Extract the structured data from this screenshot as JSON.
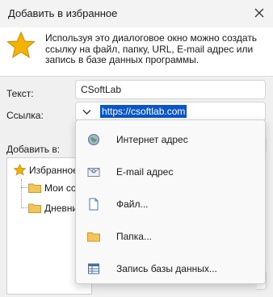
{
  "window": {
    "title": "Добавить в избранное"
  },
  "header": {
    "description": "Используя это диалоговое окно можно создать ссылку на файл, папку, URL, E-mail адрес или запись в базе данных программы.",
    "icon": "star-icon"
  },
  "form": {
    "text_label": "Текст:",
    "text_value": "CSoftLab",
    "link_label": "Ссылка:",
    "link_value": "https://csoftlab.com",
    "add_to_label": "Добавить в:"
  },
  "tree": {
    "root_label": "Избранное",
    "children": [
      {
        "label": "Мои ссы"
      },
      {
        "label": "Дневни"
      }
    ]
  },
  "dropdown": {
    "items": [
      {
        "label": "Интернет адрес",
        "icon": "globe-icon"
      },
      {
        "label": "E-mail адрес",
        "icon": "envelope-icon"
      },
      {
        "label": "Файл...",
        "icon": "file-icon"
      },
      {
        "label": "Папка...",
        "icon": "folder-icon"
      },
      {
        "label": "Запись базы данных...",
        "icon": "database-record-icon"
      }
    ]
  },
  "colors": {
    "accent": "#0a56c8",
    "star": "#f5b301",
    "folder": "#f2c45a"
  }
}
